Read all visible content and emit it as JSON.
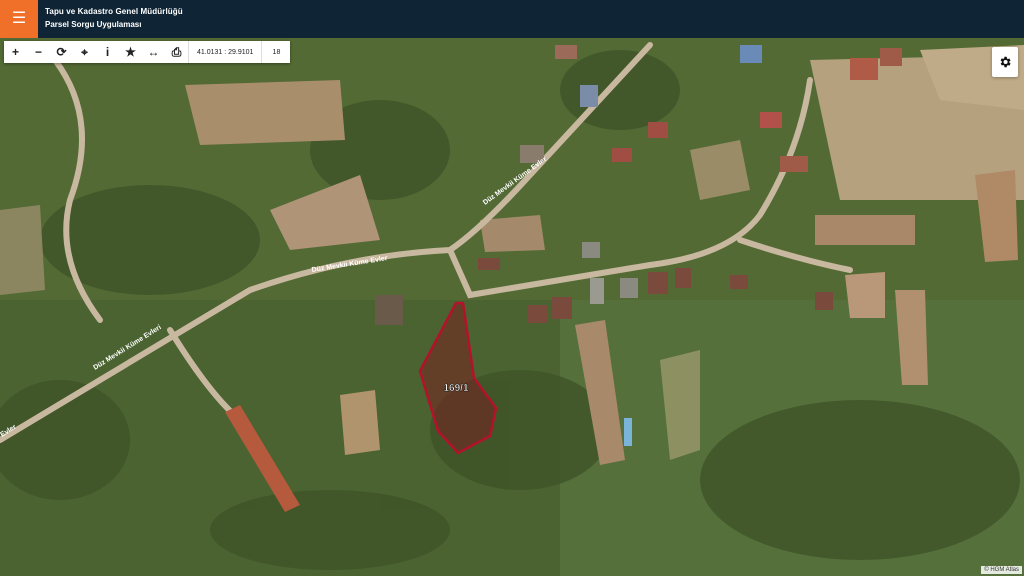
{
  "header": {
    "title_line1": "Tapu ve Kadastro Genel Müdürlüğü",
    "title_line2": "Parsel Sorgu Uygulaması",
    "menu_icon": "menu-icon",
    "accent_color": "#f0702a",
    "bar_color": "#0f2536"
  },
  "toolbar": {
    "buttons": [
      {
        "name": "zoom-in",
        "glyph": "+"
      },
      {
        "name": "zoom-out",
        "glyph": "−"
      },
      {
        "name": "refresh",
        "glyph": "⟳"
      },
      {
        "name": "locate",
        "glyph": "⌖"
      },
      {
        "name": "info",
        "glyph": "i"
      },
      {
        "name": "favorite",
        "glyph": "★"
      },
      {
        "name": "measure",
        "glyph": "↔"
      },
      {
        "name": "print",
        "glyph": "⎙"
      }
    ],
    "coordinates": "41.0131 : 29.9101",
    "zoom_level": "18"
  },
  "map": {
    "parcel_label": "169/1",
    "parcel_color": "#b3122a",
    "road_labels": [
      "Düz Mevkii Küme Evler",
      "Düz Mevkii Küme Evleri",
      "Düz Mevkii Küme Evler",
      "Evler"
    ]
  },
  "settings_icon": "gear-icon",
  "attribution": "© HGM Atlas"
}
